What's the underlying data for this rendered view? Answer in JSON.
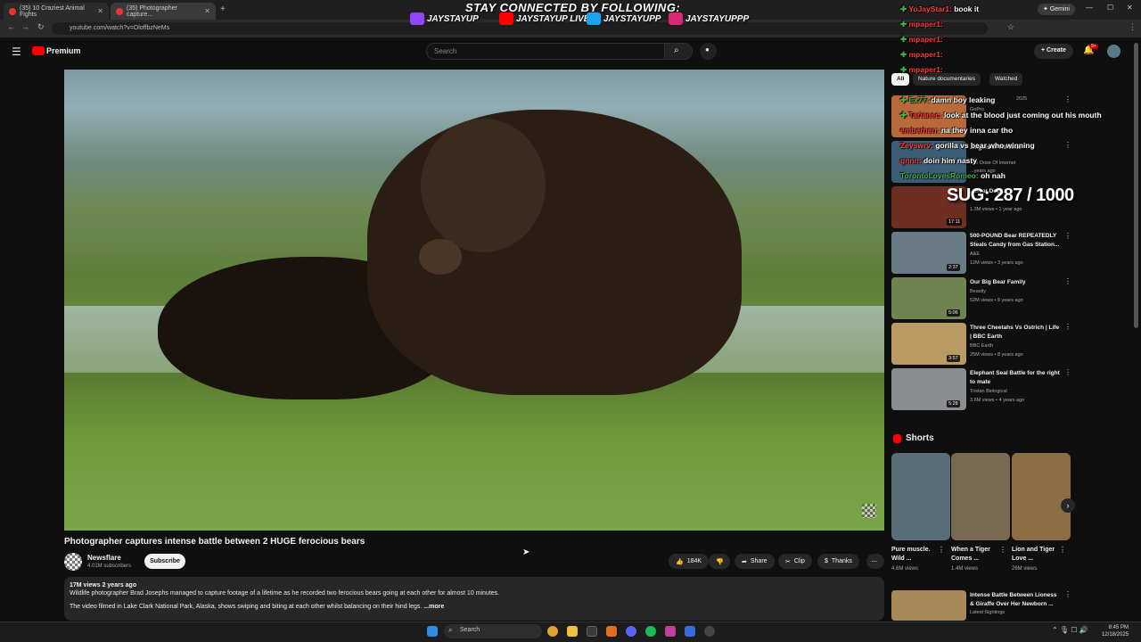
{
  "browser": {
    "tabs": [
      {
        "label": "(35) 10 Craziest Animal Fights"
      },
      {
        "label": "(35) Photographer capture..."
      }
    ],
    "url": "youtube.com/watch?v=OloffbzNeMs",
    "gemini_label": "Gemini"
  },
  "overlay": {
    "banner_title": "STAY CONNECTED BY FOLLOWING:",
    "socials": [
      {
        "platform": "twitch-icon",
        "handle": "JAYSTAYUP",
        "color": "#9146ff"
      },
      {
        "platform": "youtube-icon",
        "handle": "JAYSTAYUP LIVE",
        "color": "#ff0000"
      },
      {
        "platform": "twitter-icon",
        "handle": "JAYSTAYUPP",
        "color": "#1da1f2"
      },
      {
        "platform": "instagram-icon",
        "handle": "JAYSTAYUPPP",
        "color": "#d62976"
      }
    ],
    "sug_counter": "SUG: 287 / 1000",
    "chat": [
      {
        "user": "YoJayStar1:",
        "msg": "book it"
      },
      {
        "user": "mpaper1:",
        "msg": ""
      },
      {
        "user": "mpaper1:",
        "msg": ""
      },
      {
        "user": "mpaper1:",
        "msg": ""
      },
      {
        "user": "mpaper1:",
        "msg": ""
      },
      {
        "user": "Ex77:",
        "msg": "damn boy leaking"
      },
      {
        "user": "Tarianec:",
        "msg": "look at the blood just coming out his mouth"
      },
      {
        "user": "emberhen:",
        "msg": "na they inna car tho"
      },
      {
        "user": "Zeyswrv:",
        "msg": "gorilla vs bear who winning"
      },
      {
        "user": "gnnn:",
        "msg": "doin him nasty"
      },
      {
        "user": "TorontoLovesRomeo:",
        "msg": "oh nah"
      }
    ]
  },
  "header": {
    "logo_label": "Premium",
    "search_placeholder": "Search",
    "create_label": "Create",
    "notif_badge": "9+"
  },
  "video": {
    "title": "Photographer captures intense battle between 2 HUGE ferocious bears",
    "channel": "Newsflare",
    "subscribers": "4.01M subscribers",
    "subscribe_label": "Subscribe",
    "likes": "184K",
    "share_label": "Share",
    "clip_label": "Clip",
    "thanks_label": "Thanks",
    "views_age": "17M views  2 years ago",
    "desc_line1": "Wildlife photographer Brad Josephs managed to capture footage of a lifetime as he recorded two ferocious bears going at each other for almost 10 minutes.",
    "desc_line2": "The video filmed in Lake Clark National Park, Alaska, shows swiping and biting at each other whilst balancing on their hind legs.",
    "more_label": "...more"
  },
  "sidebar": {
    "chips": [
      "All",
      "Nature documentaries",
      "Watched"
    ],
    "recs": [
      {
        "title": "",
        "channel": "GoPro",
        "meta": "2025",
        "duration": "",
        "thumb": "#b96a3a"
      },
      {
        "title": "...ngers of All Time",
        "channel": "The Dose Of Internet",
        "meta": "...years ago",
        "duration": "",
        "thumb": "#3c5e74"
      },
      {
        "title": "...Bear Dog...",
        "channel": "",
        "meta": "1.3M views • 1 year ago",
        "duration": "17:11",
        "thumb": "#6e2e22"
      },
      {
        "title": "500-POUND Bear REPEATEDLY Steals Candy from Gas Station...",
        "channel": "A&E",
        "meta": "12M views • 3 years ago",
        "duration": "2:37",
        "thumb": "#6a7d86"
      },
      {
        "title": "Our Big Bear Family",
        "channel": "Beastly",
        "meta": "52M views • 9 years ago",
        "duration": "5:06",
        "thumb": "#6f8450"
      },
      {
        "title": "Three Cheetahs Vs Ostrich | Life | BBC Earth",
        "channel": "BBC Earth",
        "meta": "25M views • 8 years ago",
        "duration": "3:57",
        "thumb": "#b89a62"
      },
      {
        "title": "Elephant Seal Battle for the right to mate",
        "channel": "Tristan Biological",
        "meta": "3.6M views • 4 years ago",
        "duration": "5:28",
        "thumb": "#8b8e90"
      },
      {
        "title": "Intense Battle Between Lioness & Giraffe Over Her Newborn ...",
        "channel": "Latest Sightings",
        "meta": "",
        "duration": "",
        "thumb": "#a8895a"
      }
    ],
    "shorts_title": "Shorts",
    "shorts": [
      {
        "title": "Pure muscle. Wild ...",
        "views": "4.6M views",
        "thumb": "#5a6e7a"
      },
      {
        "title": "When a Tiger Comes ...",
        "views": "1.4M views",
        "thumb": "#7a6a52"
      },
      {
        "title": "Lion and Tiger Love ...",
        "views": "26M views",
        "thumb": "#8c6e44"
      }
    ]
  },
  "taskbar": {
    "search_label": "Search",
    "time": "8:45 PM",
    "date": "12/18/2025"
  }
}
